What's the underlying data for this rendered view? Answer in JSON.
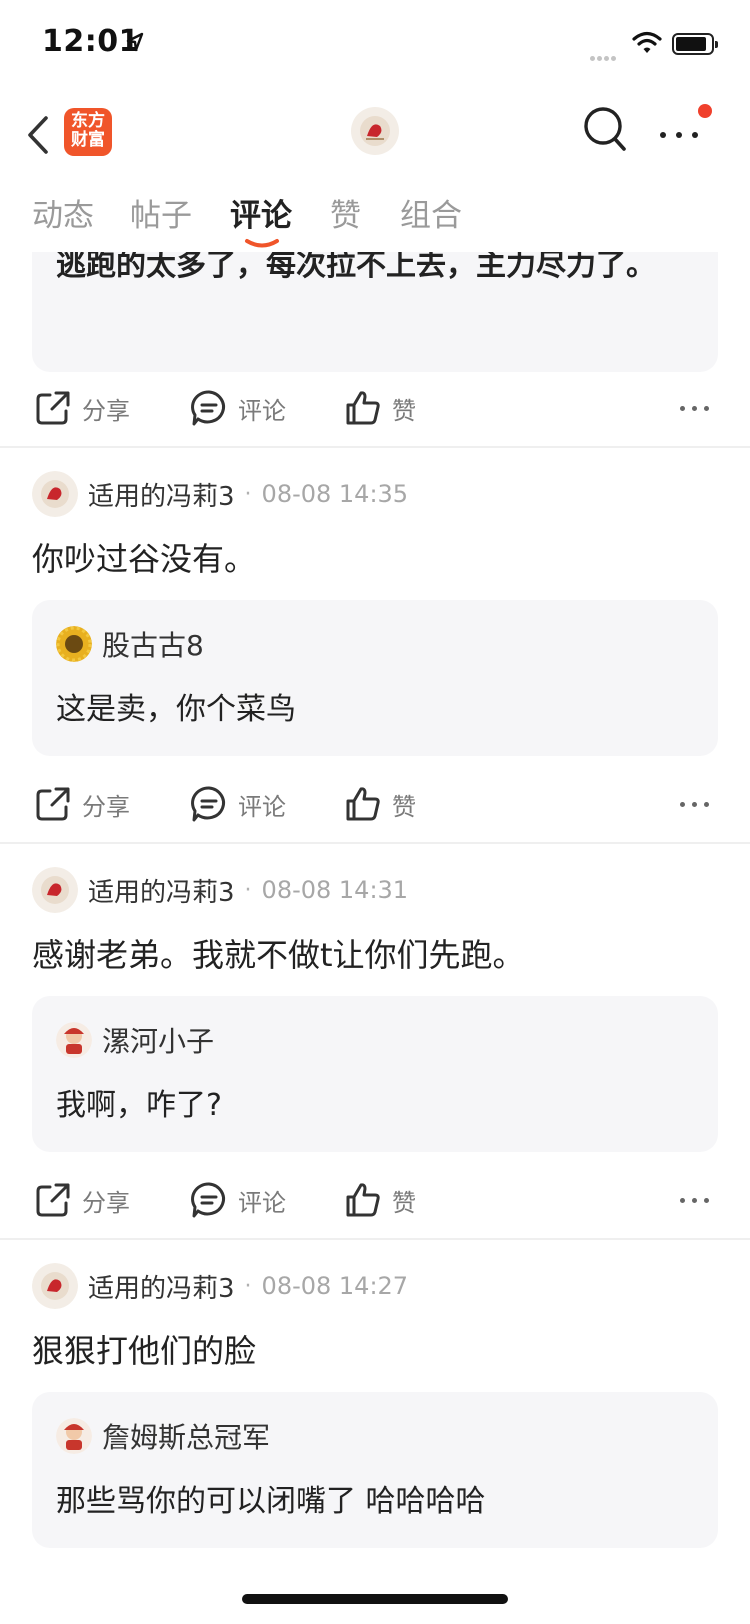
{
  "status_bar": {
    "time": "12:01"
  },
  "nav": {
    "brand_logo_line1": "东方",
    "brand_logo_line2": "财富"
  },
  "tabs": [
    {
      "label": "动态",
      "active": false
    },
    {
      "label": "帖子",
      "active": false
    },
    {
      "label": "评论",
      "active": true
    },
    {
      "label": "赞",
      "active": false
    },
    {
      "label": "组合",
      "active": false
    }
  ],
  "actions": {
    "share": "分享",
    "comment": "评论",
    "like": "赞"
  },
  "top_quote": {
    "text": "逃跑的太多了，每次拉不上去，主力尽力了。"
  },
  "posts": [
    {
      "author": "适用的冯莉3",
      "time": "08-08 14:35",
      "text": "你吵过谷没有。",
      "quote": {
        "author": "股古古8",
        "text": "这是卖，你个菜鸟"
      }
    },
    {
      "author": "适用的冯莉3",
      "time": "08-08 14:31",
      "text": "感谢老弟。我就不做t让你们先跑。",
      "quote": {
        "author": "漯河小子",
        "text": "我啊，咋了?"
      }
    },
    {
      "author": "适用的冯莉3",
      "time": "08-08 14:27",
      "text": "狠狠打他们的脸",
      "quote": {
        "author": "詹姆斯总冠军",
        "text": "那些骂你的可以闭嘴了 哈哈哈哈"
      }
    }
  ],
  "colors": {
    "accent": "#f0552a",
    "notification": "#f0402c",
    "quote_bg": "#f6f6f8"
  }
}
